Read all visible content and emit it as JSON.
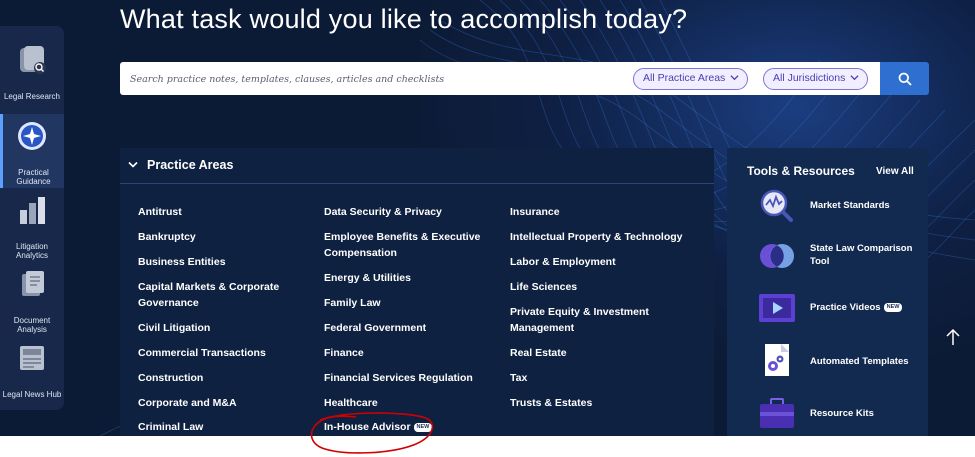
{
  "headline": "What task would you like to accomplish today?",
  "sidebar": {
    "items": [
      {
        "label": "Legal Research",
        "icon": "legal-research-icon"
      },
      {
        "label": "Practical Guidance",
        "icon": "practical-guidance-icon",
        "active": true
      },
      {
        "label": "Litigation Analytics",
        "icon": "litigation-analytics-icon"
      },
      {
        "label": "Document Analysis",
        "icon": "document-analysis-icon"
      },
      {
        "label": "Legal News Hub",
        "icon": "legal-news-hub-icon"
      }
    ]
  },
  "search": {
    "placeholder": "Search practice notes, templates, clauses, articles and checklists",
    "value": "",
    "practice_areas_filter": "All Practice Areas",
    "jurisdictions_filter": "All Jurisdictions"
  },
  "practice_areas": {
    "title": "Practice Areas",
    "columns": [
      [
        "Antitrust",
        "Bankruptcy",
        "Business Entities",
        "Capital Markets & Corporate Governance",
        "Civil Litigation",
        "Commercial Transactions",
        "Construction",
        "Corporate and M&A",
        "Criminal Law"
      ],
      [
        "Data Security & Privacy",
        "Employee Benefits & Executive Compensation",
        "Energy & Utilities",
        "Family Law",
        "Federal Government",
        "Finance",
        "Financial Services Regulation",
        "Healthcare",
        "In-House Advisor"
      ],
      [
        "Insurance",
        "Intellectual Property & Technology",
        "Labor & Employment",
        "Life Sciences",
        "Private Equity & Investment Management",
        "Real Estate",
        "Tax",
        "Trusts & Estates"
      ]
    ],
    "new_badge": "NEW"
  },
  "tools": {
    "title": "Tools & Resources",
    "view_all": "View All",
    "items": [
      {
        "label": "Market Standards",
        "icon": "market-standards-icon"
      },
      {
        "label": "State Law Comparison Tool",
        "icon": "state-law-comparison-icon"
      },
      {
        "label": "Practice Videos",
        "icon": "practice-videos-icon",
        "badge": "NEW"
      },
      {
        "label": "Automated Templates",
        "icon": "automated-templates-icon"
      },
      {
        "label": "Resource Kits",
        "icon": "resource-kits-icon"
      }
    ]
  },
  "colors": {
    "background": "#0c1b35",
    "accent": "#2f6fd0",
    "pill_border": "#7f73d6",
    "annotation": "#d10000"
  }
}
